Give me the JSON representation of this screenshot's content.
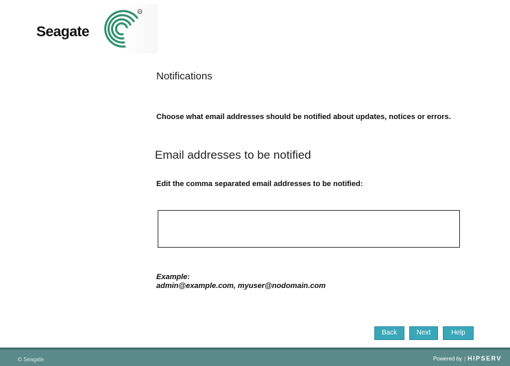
{
  "brand": {
    "logo_text": "Seagate",
    "logo_color": "#2f8f6c"
  },
  "page": {
    "title": "Notifications",
    "intro": "Choose what email addresses should be notified about updates, notices or errors.",
    "section_title": "Email addresses to be notified",
    "field_label": "Edit the comma separated email addresses to be notified:",
    "email_value": "",
    "example_label": "Example:",
    "example_value": "admin@example.com, myuser@nodomain.com"
  },
  "buttons": {
    "back": "Back",
    "next": "Next",
    "help": "Help"
  },
  "footer": {
    "copyright": "© Seagate",
    "powered_by": "Powered by",
    "separator": "|",
    "brand": "HIPSERV"
  },
  "colors": {
    "button": "#3aa6b9",
    "footer": "#5b8a8a"
  }
}
